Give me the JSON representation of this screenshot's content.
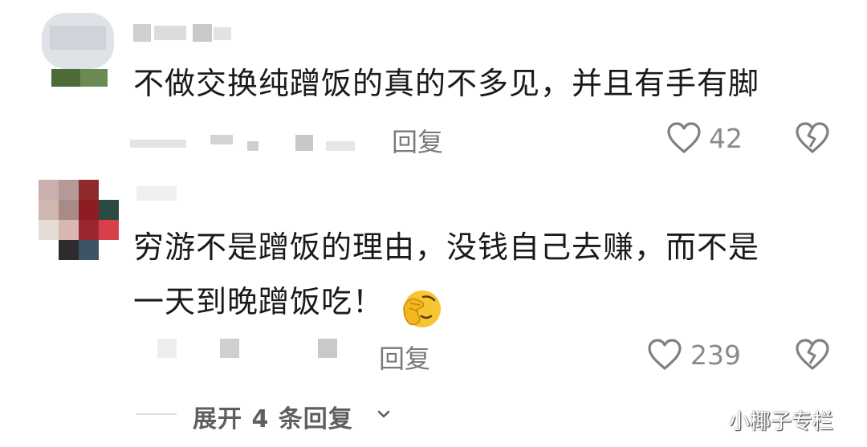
{
  "comments": [
    {
      "text": "不做交换纯蹭饭的真的不多见，并且有手有脚",
      "reply_label": "回复",
      "like_count": "42"
    },
    {
      "text_line1": "穷游不是蹭饭的理由，没钱自己去赚，而不是",
      "text_line2": "一天到晚蹭饭吃！",
      "emoji": "🤦",
      "reply_label": "回复",
      "like_count": "239"
    }
  ],
  "expand_label": "展开 4 条回复",
  "watermark": "小椰子专栏",
  "icons": [
    "heart-outline-icon",
    "heart-broken-icon",
    "chevron-down-icon",
    "face-palm-emoji"
  ]
}
